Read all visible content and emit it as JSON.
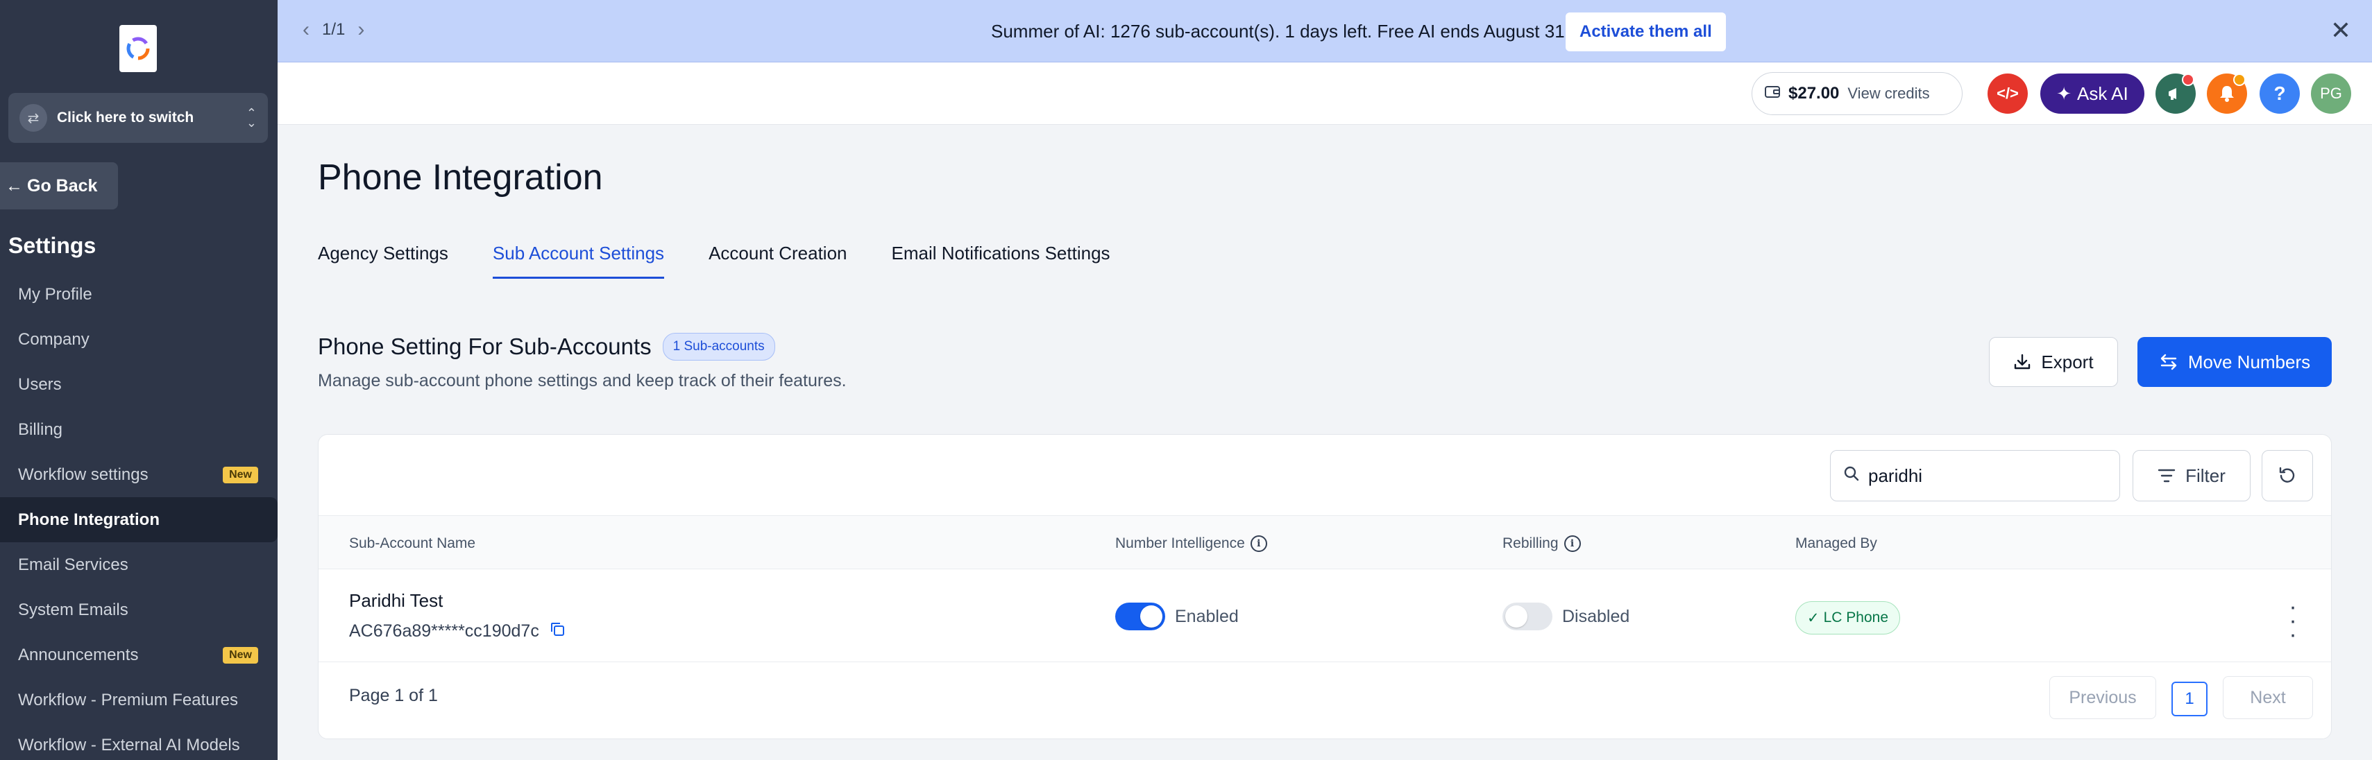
{
  "banner": {
    "pager": "1/1",
    "message": "Summer of AI: 1276 sub-account(s). 1 days left. Free AI ends August 31.",
    "activate_label": "Activate them all"
  },
  "sidebar": {
    "switcher_label": "Click here to switch",
    "go_back": "Go Back",
    "settings_title": "Settings",
    "items": [
      {
        "label": "My Profile",
        "badge": ""
      },
      {
        "label": "Company",
        "badge": ""
      },
      {
        "label": "Users",
        "badge": ""
      },
      {
        "label": "Billing",
        "badge": ""
      },
      {
        "label": "Workflow settings",
        "badge": "New"
      },
      {
        "label": "Phone Integration",
        "badge": "",
        "active": true
      },
      {
        "label": "Email Services",
        "badge": ""
      },
      {
        "label": "System Emails",
        "badge": ""
      },
      {
        "label": "Announcements",
        "badge": "New"
      },
      {
        "label": "Workflow - Premium Features",
        "badge": ""
      },
      {
        "label": "Workflow - External AI Models",
        "badge": ""
      }
    ]
  },
  "header": {
    "credits_amount": "$27.00",
    "credits_link": "View credits",
    "ask_ai": "Ask AI",
    "avatar_initials": "PG",
    "help": "?"
  },
  "page": {
    "title": "Phone Integration",
    "tabs": [
      "Agency Settings",
      "Sub Account Settings",
      "Account Creation",
      "Email Notifications Settings"
    ],
    "active_tab": "Sub Account Settings",
    "section_title": "Phone Setting For Sub-Accounts",
    "section_badge": "1 Sub-accounts",
    "section_subtitle": "Manage sub-account phone settings and keep track of their features.",
    "export_label": "Export",
    "move_label": "Move Numbers"
  },
  "table": {
    "search_value": "paridhi",
    "filter_label": "Filter",
    "columns": [
      "Sub-Account Name",
      "Number Intelligence",
      "Rebilling",
      "Managed By"
    ],
    "rows": [
      {
        "name": "Paridhi Test",
        "sid": "AC676a89*****cc190d7c",
        "number_intelligence": "Enabled",
        "number_intelligence_on": true,
        "rebilling": "Disabled",
        "rebilling_on": false,
        "managed_by": "LC Phone"
      }
    ],
    "page_info": "Page 1 of 1",
    "prev_label": "Previous",
    "current_page": "1",
    "next_label": "Next"
  },
  "colors": {
    "accent": "#155eef",
    "sidebar_bg": "#2e3648",
    "banner_bg": "#c2d3fb",
    "ask_ai_bg": "#3b1e8f",
    "code_btn": "#e5352b",
    "megaphone_btn": "#2f6f5b",
    "bell_btn": "#f97316",
    "help_btn": "#3b82f6",
    "avatar_bg": "#6fae7a"
  }
}
